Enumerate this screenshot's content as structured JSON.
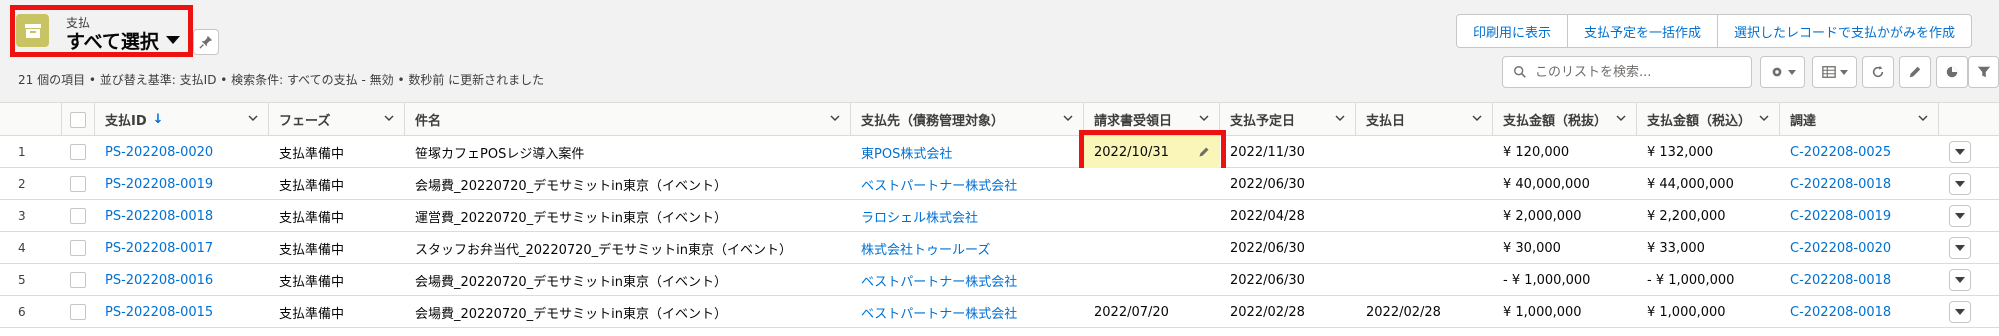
{
  "header": {
    "object_label": "支払",
    "view_title": "すべて選択",
    "status_line": "21 個の項目 • 並び替え基準: 支払ID • 検索条件: すべての支払 - 無効 • 数秒前 に更新されました"
  },
  "actions": {
    "print": "印刷用に表示",
    "bulk_create": "支払予定を一括作成",
    "create_from_selected": "選択したレコードで支払かがみを作成"
  },
  "search": {
    "placeholder": "このリストを検索..."
  },
  "columns": [
    "支払ID",
    "フェーズ",
    "件名",
    "支払先（債務管理対象）",
    "請求書受領日",
    "支払予定日",
    "支払日",
    "支払金額（税抜）",
    "支払金額（税込）",
    "調達"
  ],
  "rows": [
    {
      "num": "1",
      "id": "PS-202208-0020",
      "phase": "支払準備中",
      "subject": "笹塚カフェPOSレジ導入案件",
      "vendor": "東POS株式会社",
      "invoice_date": "2022/10/31",
      "scheduled": "2022/11/30",
      "paid": "",
      "amount_ex": "¥ 120,000",
      "amount_in": "¥ 132,000",
      "procurement": "C-202208-0025"
    },
    {
      "num": "2",
      "id": "PS-202208-0019",
      "phase": "支払準備中",
      "subject": "会場費_20220720_デモサミットin東京（イベント）",
      "vendor": "ベストパートナー株式会社",
      "invoice_date": "",
      "scheduled": "2022/06/30",
      "paid": "",
      "amount_ex": "¥ 40,000,000",
      "amount_in": "¥ 44,000,000",
      "procurement": "C-202208-0018"
    },
    {
      "num": "3",
      "id": "PS-202208-0018",
      "phase": "支払準備中",
      "subject": "運営費_20220720_デモサミットin東京（イベント）",
      "vendor": "ラロシェル株式会社",
      "invoice_date": "",
      "scheduled": "2022/04/28",
      "paid": "",
      "amount_ex": "¥ 2,000,000",
      "amount_in": "¥ 2,200,000",
      "procurement": "C-202208-0019"
    },
    {
      "num": "4",
      "id": "PS-202208-0017",
      "phase": "支払準備中",
      "subject": "スタッフお弁当代_20220720_デモサミットin東京（イベント）",
      "vendor": "株式会社トゥールーズ",
      "invoice_date": "",
      "scheduled": "2022/06/30",
      "paid": "",
      "amount_ex": "¥ 30,000",
      "amount_in": "¥ 33,000",
      "procurement": "C-202208-0020"
    },
    {
      "num": "5",
      "id": "PS-202208-0016",
      "phase": "支払準備中",
      "subject": "会場費_20220720_デモサミットin東京（イベント）",
      "vendor": "ベストパートナー株式会社",
      "invoice_date": "",
      "scheduled": "2022/06/30",
      "paid": "",
      "amount_ex": "- ¥ 1,000,000",
      "amount_in": "- ¥ 1,000,000",
      "procurement": "C-202208-0018"
    },
    {
      "num": "6",
      "id": "PS-202208-0015",
      "phase": "支払準備中",
      "subject": "会場費_20220720_デモサミットin東京（イベント）",
      "vendor": "ベストパートナー株式会社",
      "invoice_date": "2022/07/20",
      "scheduled": "2022/02/28",
      "paid": "2022/02/28",
      "amount_ex": "¥ 1,000,000",
      "amount_in": "¥ 1,000,000",
      "procurement": "C-202208-0018"
    }
  ],
  "colors": {
    "accent": "#0070d2",
    "highlight": "#ee1111",
    "object_icon": "#c8c363",
    "edit_cell": "#faf5b8"
  }
}
